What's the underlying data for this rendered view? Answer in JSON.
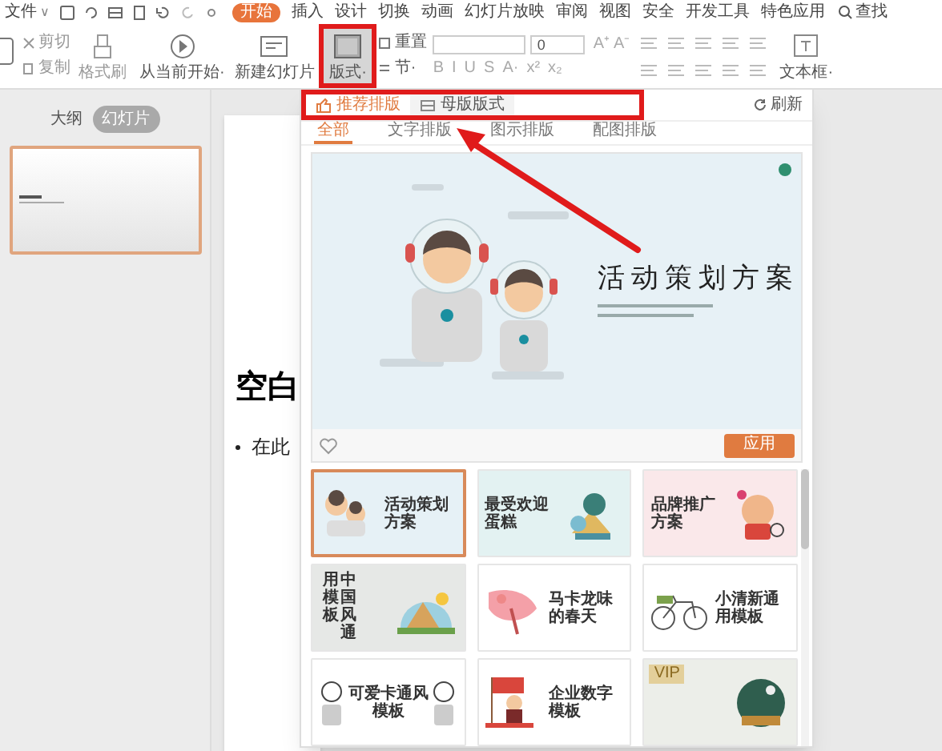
{
  "menu_bar": {
    "file": "文件",
    "file_caret": "∨",
    "tabs": [
      {
        "label": "开始",
        "selected": true
      },
      {
        "label": "插入",
        "selected": false
      },
      {
        "label": "设计",
        "selected": false
      },
      {
        "label": "切换",
        "selected": false
      },
      {
        "label": "动画",
        "selected": false
      },
      {
        "label": "幻灯片放映",
        "selected": false
      },
      {
        "label": "审阅",
        "selected": false
      },
      {
        "label": "视图",
        "selected": false
      },
      {
        "label": "安全",
        "selected": false
      },
      {
        "label": "开发工具",
        "selected": false
      },
      {
        "label": "特色应用",
        "selected": false
      }
    ],
    "search": "查找"
  },
  "ribbon": {
    "cut": "剪切",
    "copy": "复制",
    "format_painter": "格式刷",
    "from_current": "从当前开始·",
    "new_slide": "新建幻灯片",
    "layout": {
      "label": "版式·",
      "highlighted": true
    },
    "reset": "重置",
    "section": "节·",
    "font_size": "0",
    "grow": "A⁺",
    "shrink": "A⁻",
    "format_buttons": [
      "B",
      "I",
      "U",
      "S",
      "A·",
      "x²",
      "x₂"
    ],
    "text_box": "文本框·"
  },
  "side_panel": {
    "tabs": [
      {
        "label": "大纲",
        "selected": false
      },
      {
        "label": "幻灯片",
        "selected": true
      }
    ],
    "thumbnail": {
      "selected": true
    }
  },
  "slide": {
    "title": "空白",
    "bullet": "在此"
  },
  "layout_panel": {
    "tabs_highlighted": true,
    "tabs": [
      {
        "label": "推荐排版",
        "selected": true
      },
      {
        "label": "母版版式",
        "selected": false
      }
    ],
    "refresh": "刷新",
    "filters": [
      {
        "label": "全部",
        "selected": true
      },
      {
        "label": "文字排版",
        "selected": false
      },
      {
        "label": "图示排版",
        "selected": false
      },
      {
        "label": "配图排版",
        "selected": false
      }
    ],
    "preview": {
      "title": "活动策划方案",
      "liked": false,
      "apply": "应用"
    },
    "templates": [
      {
        "kind": "art-left",
        "title": "活动策划方案",
        "selected": true,
        "vip": false
      },
      {
        "kind": "art-right",
        "title": "最受欢迎蛋糕",
        "selected": false,
        "vip": false
      },
      {
        "kind": "art-right",
        "title": "品牌推广方案",
        "selected": false,
        "vip": false
      },
      {
        "kind": "vertical",
        "title": "中国风通用模板",
        "selected": false,
        "vip": false
      },
      {
        "kind": "art-left",
        "title": "马卡龙味的春天",
        "selected": false,
        "vip": false
      },
      {
        "kind": "art-left",
        "title": "小清新通用模板",
        "selected": false,
        "vip": false
      },
      {
        "kind": "center",
        "title": "可爱卡通风模板",
        "selected": false,
        "vip": false
      },
      {
        "kind": "art-left",
        "title": "企业数字模板",
        "selected": false,
        "vip": false
      },
      {
        "kind": "art-right",
        "selected": false,
        "vip": true,
        "badge": "VIP"
      }
    ]
  },
  "annotations": {
    "arrow": true
  }
}
